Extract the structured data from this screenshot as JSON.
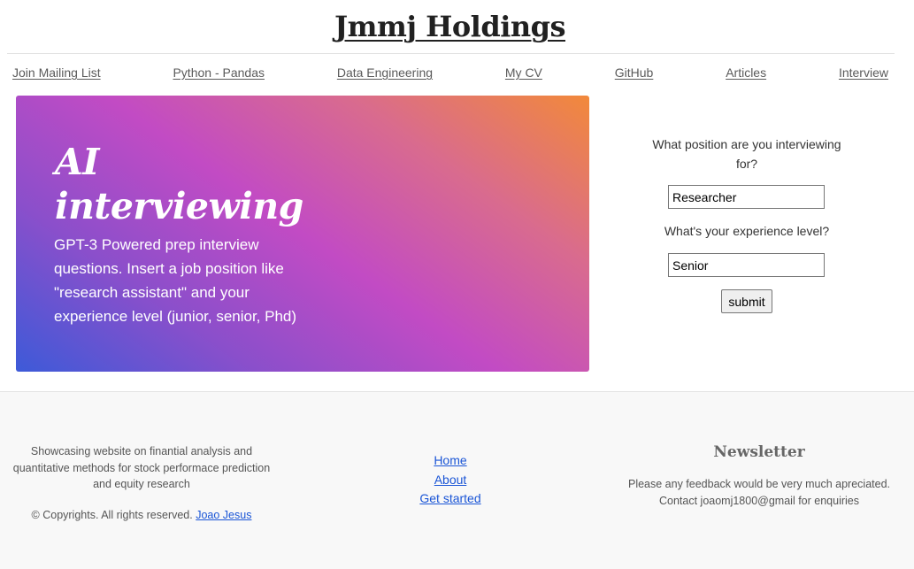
{
  "header": {
    "title": "Jmmj Holdings"
  },
  "nav": {
    "items": [
      {
        "label": "Join Mailing List"
      },
      {
        "label": "Python - Pandas"
      },
      {
        "label": "Data Engineering"
      },
      {
        "label": "My CV"
      },
      {
        "label": "GitHub"
      },
      {
        "label": "Articles"
      },
      {
        "label": "Interview"
      }
    ]
  },
  "hero": {
    "title_line1": "AI",
    "title_line2": "interviewing",
    "description": "GPT-3 Powered prep interview questions. Insert a job position like \"research assistant\" and your experience level (junior, senior, Phd)",
    "gradient_colors": [
      "#3d5ad8",
      "#c24bc4",
      "#f2893a"
    ]
  },
  "form": {
    "position_label": "What position are you interviewing for?",
    "position_value": "Researcher",
    "experience_label": "What's your experience level?",
    "experience_value": "Senior",
    "submit_label": "submit"
  },
  "footer": {
    "about_text": "Showcasing website on finantial analysis and quantitative methods for stock performace prediction and equity research",
    "copyright_text": "© Copyrights. All rights reserved.",
    "copyright_link": "Joao Jesus",
    "links": [
      {
        "label": "Home"
      },
      {
        "label": "About"
      },
      {
        "label": "Get started"
      }
    ],
    "newsletter_title": "Newsletter",
    "newsletter_text": "Please any feedback would be very much apreciated. Contact joaomj1800@gmail for enquiries"
  },
  "colors": {
    "link": "#1a55d6",
    "nav_link": "#5a5a5a",
    "footer_bg": "#f8f8f8"
  }
}
